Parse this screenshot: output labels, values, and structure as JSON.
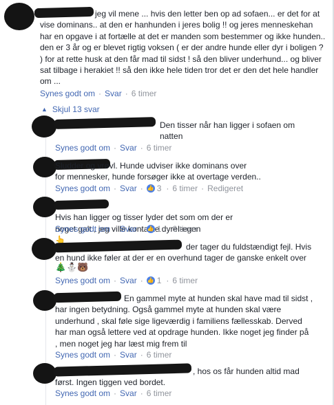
{
  "main_comment": {
    "text": "jeg vil mene ... hvis den letter ben op ad sofaen... er det for at\nvise dominans.. at den er hanhunden i jeres bolig !! og jeres menneskehan\nhar en opgave i at fortælle at det er manden som bestemmer og ikke hunden..\nden er 3 år og er blevet rigtig voksen ( er der andre hunde eller dyr i boligen ?\n) for at rette husk at den får mad til sidst ! så den bliver underhund... og bliver\nsat tilbage i herakiet !! så den ikke hele tiden tror det er den det hele handler\nom ...",
    "like_label": "Synes godt om",
    "reply_label": "Svar",
    "time": "6 timer"
  },
  "hide_replies_label": "Skjul 13 svar",
  "replies": [
    {
      "text": "Den tisser når han ligger i sofaen om\nnatten",
      "like_label": "Synes godt om",
      "reply_label": "Svar",
      "time": "6 timer"
    },
    {
      "text": "Sludder og vrøvl. Hunde udviser ikke dominans over\nfor mennesker, hunde forsøger ikke at overtage verden..",
      "like_label": "Synes godt om",
      "reply_label": "Svar",
      "likes": "3",
      "time": "6 timer",
      "edited_label": "Redigeret"
    },
    {
      "text": "Hvis han ligger og tisser lyder det som om der er\nnoget galt , jeg ville kontakte dyrelægen",
      "emoji": "👆",
      "like_label": "Synes godt om",
      "reply_label": "Svar",
      "likes": "1",
      "time": "6 timer"
    },
    {
      "text": "der tager du fuldstændigt fejl. Hvis\nen hund ikke føler at der er en overhund tager de ganske enkelt over",
      "emojis": "🎄⛄🐻",
      "like_label": "Synes godt om",
      "reply_label": "Svar",
      "likes": "1",
      "time": "6 timer"
    },
    {
      "text": "En gammel myte at hunden skal have mad til sidst ,\nhar ingen betydning. Også gammel myte at hunden skal være\nunderhund , skal føle sige ligeværdig i familiens fællesskab. Derved\nhar man også lettere ved at opdrage hunden. Ikke noget jeg finder på\n, men noget jeg har læst mig frem til",
      "like_label": "Synes godt om",
      "reply_label": "Svar",
      "time": "6 timer"
    },
    {
      "text": ", hos os får hunden altid mad\nførst. Ingen tiggen ved bordet.",
      "like_label": "Synes godt om",
      "reply_label": "Svar",
      "time": "6 timer"
    }
  ]
}
